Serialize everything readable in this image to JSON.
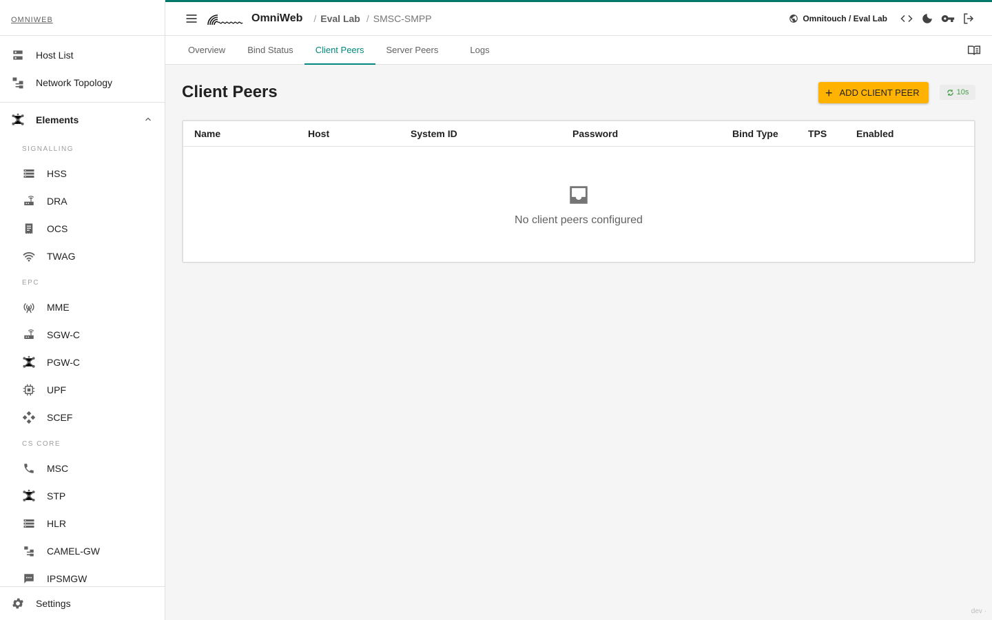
{
  "brand": "OMNIWEB",
  "sidebar": {
    "top_items": [
      {
        "label": "Host List",
        "icon": "dns-icon"
      },
      {
        "label": "Network Topology",
        "icon": "account-tree-icon"
      }
    ],
    "elements_label": "Elements",
    "sections": [
      {
        "label": "SIGNALLING",
        "items": [
          {
            "label": "HSS",
            "icon": "storage-icon"
          },
          {
            "label": "DRA",
            "icon": "router-icon"
          },
          {
            "label": "OCS",
            "icon": "receipt-icon"
          },
          {
            "label": "TWAG",
            "icon": "wifi-icon"
          }
        ]
      },
      {
        "label": "EPC",
        "items": [
          {
            "label": "MME",
            "icon": "antenna-icon"
          },
          {
            "label": "SGW-C",
            "icon": "router-icon"
          },
          {
            "label": "PGW-C",
            "icon": "hub-icon"
          },
          {
            "label": "UPF",
            "icon": "chip-icon"
          },
          {
            "label": "SCEF",
            "icon": "api-icon"
          }
        ]
      },
      {
        "label": "CS CORE",
        "items": [
          {
            "label": "MSC",
            "icon": "phone-icon"
          },
          {
            "label": "STP",
            "icon": "hub-icon"
          },
          {
            "label": "HLR",
            "icon": "storage-icon"
          },
          {
            "label": "CAMEL-GW",
            "icon": "account-tree-icon"
          },
          {
            "label": "IPSMGW",
            "icon": "sms-icon"
          }
        ]
      }
    ],
    "settings_label": "Settings"
  },
  "topbar": {
    "app_title": "OmniWeb",
    "breadcrumb": [
      "Eval Lab",
      "SMSC-SMPP"
    ],
    "tenant": "Omnitouch / Eval Lab"
  },
  "tabs": [
    "Overview",
    "Bind Status",
    "Client Peers",
    "Server Peers",
    "Logs"
  ],
  "active_tab": "Client Peers",
  "main": {
    "title": "Client Peers",
    "add_button": "ADD CLIENT PEER",
    "refresh_interval": "10s",
    "columns": [
      "Name",
      "Host",
      "System ID",
      "Password",
      "Bind Type",
      "TPS",
      "Enabled"
    ],
    "empty_text": "No client peers configured"
  },
  "footer_tag": "dev ·",
  "colors": {
    "accent": "#00897b",
    "topbar_border": "#00796b",
    "button": "#ffb300",
    "refresh": "#43a047"
  }
}
